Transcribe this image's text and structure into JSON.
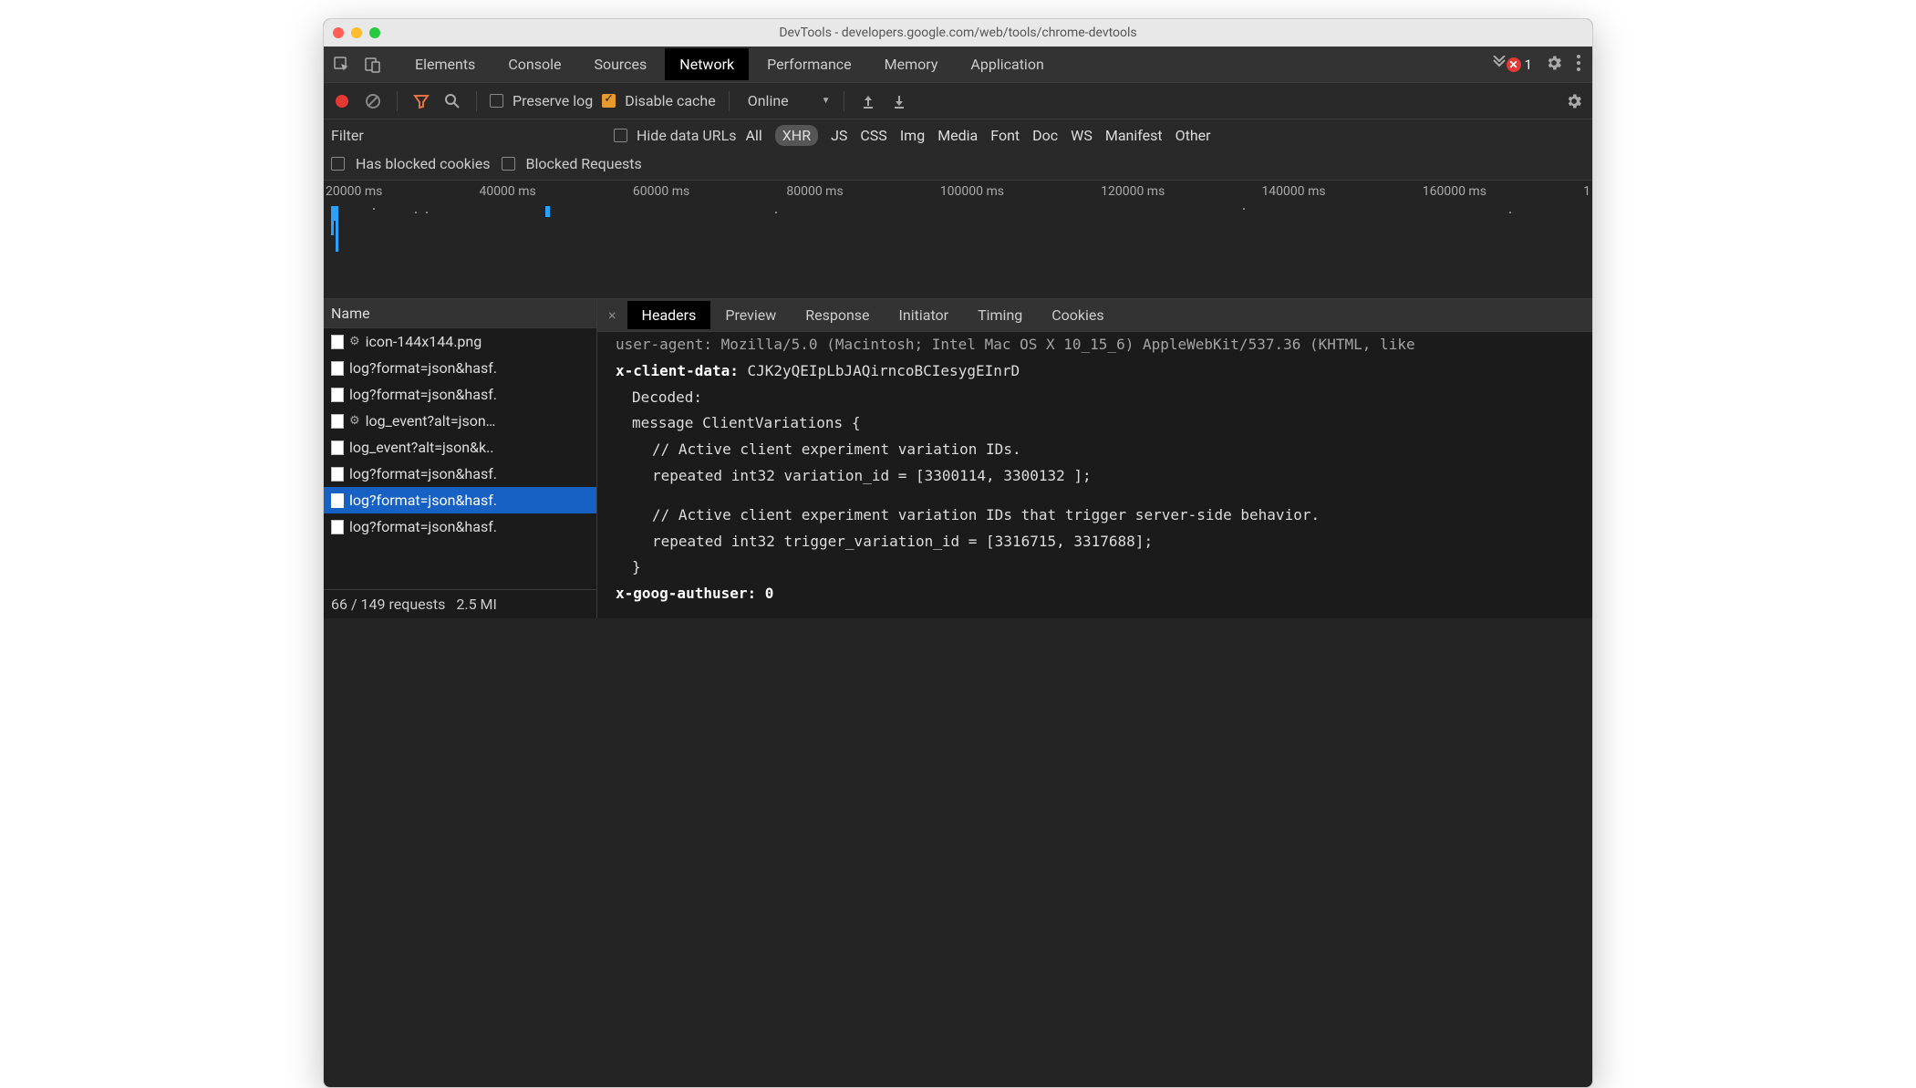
{
  "window": {
    "title": "DevTools - developers.google.com/web/tools/chrome-devtools"
  },
  "tabs": {
    "items": [
      "Elements",
      "Console",
      "Sources",
      "Network",
      "Performance",
      "Memory",
      "Application"
    ],
    "active": "Network",
    "error_count": "1"
  },
  "toolbar": {
    "preserve_log": "Preserve log",
    "disable_cache": "Disable cache",
    "throttle": "Online"
  },
  "filterbar": {
    "filter_label": "Filter",
    "hide_data_urls": "Hide data URLs",
    "types": [
      "All",
      "XHR",
      "JS",
      "CSS",
      "Img",
      "Media",
      "Font",
      "Doc",
      "WS",
      "Manifest",
      "Other"
    ],
    "type_active": "XHR",
    "has_blocked_cookies": "Has blocked cookies",
    "blocked_requests": "Blocked Requests"
  },
  "timeline": {
    "ticks": [
      "20000 ms",
      "40000 ms",
      "60000 ms",
      "80000 ms",
      "100000 ms",
      "120000 ms",
      "140000 ms",
      "160000 ms",
      "1"
    ]
  },
  "requests": {
    "header": "Name",
    "items": [
      {
        "name": "icon-144x144.png",
        "gear": true
      },
      {
        "name": "log?format=json&hasf.",
        "gear": false
      },
      {
        "name": "log?format=json&hasf.",
        "gear": false
      },
      {
        "name": "log_event?alt=json…",
        "gear": true
      },
      {
        "name": "log_event?alt=json&k..",
        "gear": false
      },
      {
        "name": "log?format=json&hasf.",
        "gear": false
      },
      {
        "name": "log?format=json&hasf.",
        "gear": false
      },
      {
        "name": "log?format=json&hasf.",
        "gear": false
      }
    ],
    "selected_index": 6,
    "footer_left": "66 / 149 requests",
    "footer_right": "2.5 MI"
  },
  "detail": {
    "tabs": [
      "Headers",
      "Preview",
      "Response",
      "Initiator",
      "Timing",
      "Cookies"
    ],
    "active": "Headers",
    "ua_line": "user-agent: Mozilla/5.0 (Macintosh; Intel Mac OS X 10_15_6) AppleWebKit/537.36 (KHTML, like",
    "xcd_label": "x-client-data:",
    "xcd_value": "CJK2yQEIpLbJAQirncoBCIesygEInrD",
    "decoded_label": "Decoded:",
    "l1": "message ClientVariations {",
    "l2": "// Active client experiment variation IDs.",
    "l3": "repeated int32 variation_id = [3300114, 3300132 ];",
    "l4": "// Active client experiment variation IDs that trigger server-side behavior.",
    "l5": "repeated int32 trigger_variation_id = [3316715, 3317688];",
    "l6": "}",
    "xgoog": "x-goog-authuser: 0"
  }
}
